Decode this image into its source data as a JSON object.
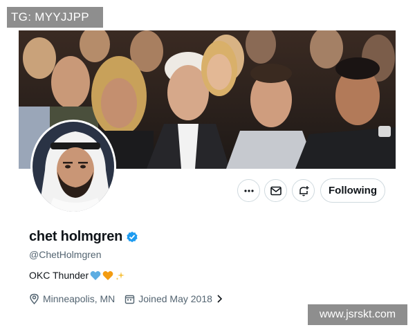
{
  "watermarks": {
    "top_left": "TG: MYYJJPP",
    "bottom_right": "www.jsrskt.com"
  },
  "profile": {
    "display_name": "chet holmgren",
    "verified": true,
    "handle": "@ChetHolmgren",
    "bio_text": "OKC Thunder",
    "bio_emojis": [
      "blue-heart",
      "orange-heart",
      "sparkles"
    ],
    "location": "Minneapolis, MN",
    "joined": "Joined May 2018"
  },
  "actions": {
    "more_icon": "ellipsis-icon",
    "message_icon": "envelope-icon",
    "notify_icon": "bell-plus-icon",
    "follow_label": "Following"
  },
  "colors": {
    "verified_badge": "#1d9bf0",
    "secondary_text": "#536471",
    "border": "#cfd9de"
  }
}
